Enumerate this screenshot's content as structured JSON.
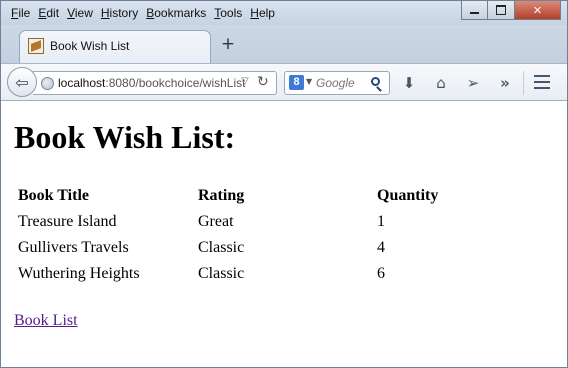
{
  "menu": [
    {
      "key": "F",
      "rest": "ile"
    },
    {
      "key": "E",
      "rest": "dit"
    },
    {
      "key": "V",
      "rest": "iew"
    },
    {
      "key": "H",
      "rest": "istory"
    },
    {
      "key": "B",
      "rest": "ookmarks"
    },
    {
      "key": "T",
      "rest": "ools"
    },
    {
      "key": "H",
      "rest": "elp"
    }
  ],
  "tab": {
    "title": "Book Wish List"
  },
  "address": {
    "host": "localhost",
    "path": ":8080/bookchoice/wishList"
  },
  "search": {
    "placeholder": "Google",
    "engine_letter": "8"
  },
  "page": {
    "heading": "Book Wish List:",
    "columns": [
      "Book Title",
      "Rating",
      "Quantity"
    ],
    "rows": [
      {
        "title": "Treasure Island",
        "rating": "Great",
        "quantity": "1"
      },
      {
        "title": "Gullivers Travels",
        "rating": "Classic",
        "quantity": "4"
      },
      {
        "title": "Wuthering Heights",
        "rating": "Classic",
        "quantity": "6"
      }
    ],
    "link": "Book List"
  },
  "colors": {
    "link_visited": "#551a8b",
    "close_button": "#c0503a"
  },
  "icons": [
    "back-icon",
    "globe-icon",
    "reload-icon",
    "search-icon",
    "download-icon",
    "home-icon",
    "send-icon",
    "overflow-icon",
    "menu-icon"
  ]
}
